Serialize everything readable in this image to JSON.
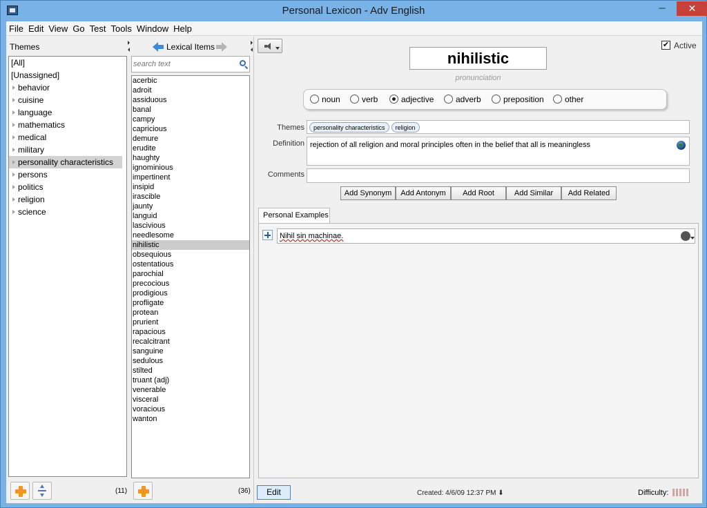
{
  "window": {
    "title": "Personal Lexicon - Adv English",
    "minimize": "─",
    "maximize": "□",
    "close": "✕"
  },
  "menu": [
    "File",
    "Edit",
    "View",
    "Go",
    "Test",
    "Tools",
    "Window",
    "Help"
  ],
  "themes": {
    "header": "Themes",
    "items": [
      "[All]",
      "[Unassigned]",
      "behavior",
      "cuisine",
      "language",
      "mathematics",
      "medical",
      "military",
      "personality characteristics",
      "persons",
      "politics",
      "religion",
      "science"
    ],
    "selected": "personality characteristics",
    "count": "(11)"
  },
  "lexical": {
    "header": "Lexical Items",
    "search_placeholder": "search text",
    "items": [
      "acerbic",
      "adroit",
      "assiduous",
      "banal",
      "campy",
      "capricious",
      "demure",
      "erudite",
      "haughty",
      "ignominious",
      "impertinent",
      "insipid",
      "irascible",
      "jaunty",
      "languid",
      "lascivious",
      "needlesome",
      "nihilistic",
      "obsequious",
      "ostentatious",
      "parochial",
      "precocious",
      "prodigious",
      "profligate",
      "protean",
      "prurient",
      "rapacious",
      "recalcitrant",
      "sanguine",
      "sedulous",
      "stilted",
      "truant (adj)",
      "venerable",
      "visceral",
      "voracious",
      "wanton"
    ],
    "selected": "nihilistic",
    "count": "(36)"
  },
  "detail": {
    "active_label": "Active",
    "active_checked": true,
    "word": "nihilistic",
    "pronunciation": "pronunciation",
    "parts_of_speech": [
      "noun",
      "verb",
      "adjective",
      "adverb",
      "preposition",
      "other"
    ],
    "selected_pos": "adjective",
    "themes_label": "Themes",
    "themes_tags": [
      "personality characteristics",
      "religion"
    ],
    "definition_label": "Definition",
    "definition": "rejection of all religion and moral principles often in the belief that all is meaningless",
    "comments_label": "Comments",
    "comments": "",
    "add_buttons": [
      "Add Synonym",
      "Add Antonym",
      "Add Root",
      "Add Similar",
      "Add Related"
    ],
    "examples_tab": "Personal Examples",
    "example_text": "Nihil sin machinae.",
    "edit_button": "Edit",
    "created": "Created:  4/6/09 12:37 PM ⬇",
    "difficulty_label": "Difficulty:"
  }
}
